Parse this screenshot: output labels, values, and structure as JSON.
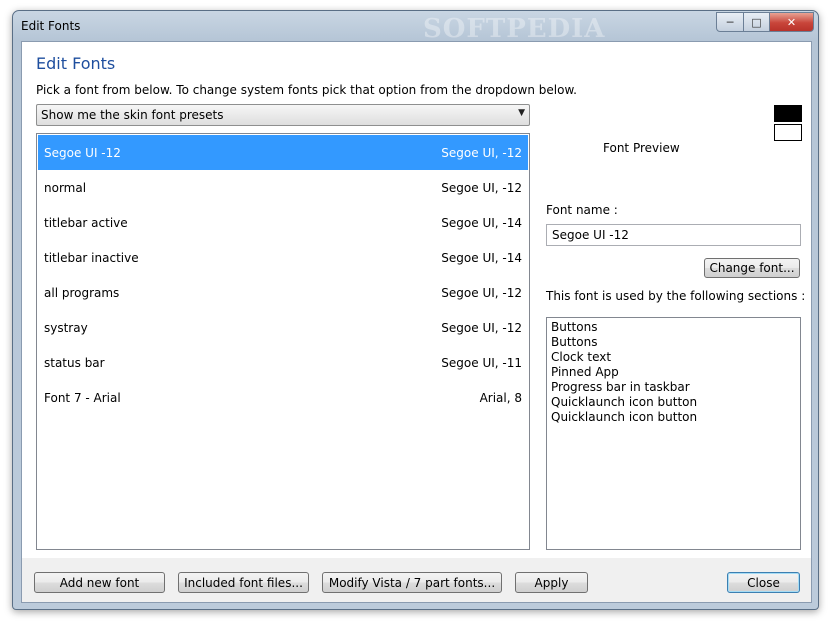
{
  "window": {
    "title": "Edit Fonts",
    "watermark": "SOFTPEDIA"
  },
  "header": {
    "heading": "Edit Fonts",
    "instruction": "Pick a font from below.  To change system fonts pick that option from the dropdown below."
  },
  "dropdown": {
    "selected": "Show me the skin font presets"
  },
  "font_list": [
    {
      "name": "Segoe UI -12",
      "value": "Segoe UI, -12",
      "selected": true
    },
    {
      "name": "normal",
      "value": "Segoe UI, -12"
    },
    {
      "name": "titlebar active",
      "value": "Segoe UI, -14"
    },
    {
      "name": "titlebar inactive",
      "value": "Segoe UI, -14"
    },
    {
      "name": "all programs",
      "value": "Segoe UI, -12"
    },
    {
      "name": "systray",
      "value": "Segoe UI, -12"
    },
    {
      "name": "status bar",
      "value": "Segoe UI, -11"
    },
    {
      "name": "Font 7 - Arial",
      "value": "Arial, 8"
    }
  ],
  "preview": {
    "label": "Font Preview",
    "swatch_top_color": "#000000",
    "swatch_bottom_color": "#ffffff"
  },
  "details": {
    "font_name_label": "Font name :",
    "font_name_value": "Segoe UI -12",
    "change_font_button": "Change font...",
    "used_by_label": "This font is used by the following sections :",
    "sections": [
      "Buttons",
      "Buttons",
      "Clock text",
      "Pinned App",
      "Progress bar in taskbar",
      "Quicklaunch icon button",
      "Quicklaunch icon button"
    ]
  },
  "footer": {
    "add_new_font": "Add new font",
    "included_font_files": "Included font files...",
    "modify_vista": "Modify Vista / 7 part fonts...",
    "apply": "Apply",
    "close": "Close"
  },
  "colors": {
    "accent": "#1e4e9e",
    "selection": "#3399ff"
  }
}
